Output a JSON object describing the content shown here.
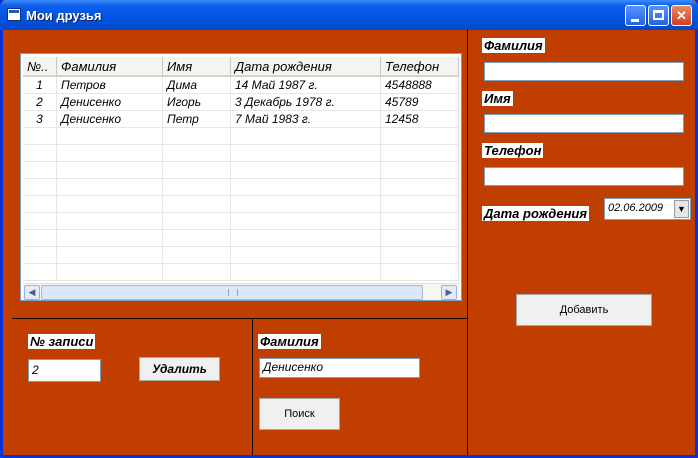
{
  "window": {
    "title": "Мои друзья"
  },
  "grid": {
    "columns": [
      "№..",
      "Фамилия",
      "Имя",
      "Дата рождения",
      "Телефон"
    ],
    "rows": [
      [
        "1",
        "Петров",
        "Дима",
        "14 Май 1987 г.",
        "4548888"
      ],
      [
        "2",
        "Денисенко",
        "Игорь",
        "3 Декабрь 1978 г.",
        "45789"
      ],
      [
        "3",
        "Денисенко",
        "Петр",
        "7 Май 1983 г.",
        "12458"
      ]
    ]
  },
  "add_form": {
    "surname_label": "Фамилия",
    "surname_value": "",
    "name_label": "Имя",
    "name_value": "",
    "phone_label": "Телефон",
    "phone_value": "",
    "birthdate_label": "Дата рождения",
    "birthdate_value": "02.06.2009",
    "add_button": "Добавить"
  },
  "delete_form": {
    "record_label": "№ записи",
    "record_value": "2",
    "delete_button": "Удалить"
  },
  "search_form": {
    "surname_label": "Фамилия",
    "surname_value": "Денисенко",
    "search_button": "Поиск"
  }
}
